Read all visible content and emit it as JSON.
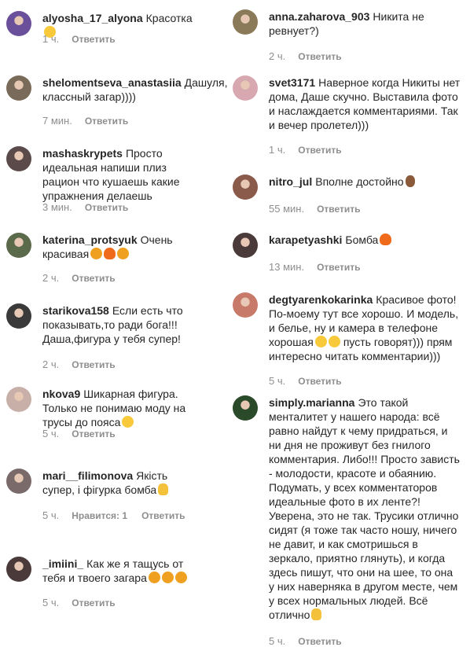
{
  "reply_label": "Ответить",
  "left_column": [
    {
      "user": "alyosha_17_alyona",
      "text": "Красотка",
      "emoji": [
        "smile"
      ],
      "time": "1 ч.",
      "likes": "",
      "avatar_color": "#6a4f9a"
    },
    {
      "user": "shelomentseva_anastasiia",
      "text": "Дашуля, классный загар))))",
      "emoji": [],
      "time": "7 мин.",
      "likes": "",
      "avatar_color": "#7a6a5a"
    },
    {
      "user": "mashaskrypets",
      "text": "Просто идеальная напиши плиз рацион что кушаешь какие упражнения делаешь",
      "emoji": [],
      "time": "3 мин.",
      "likes": "",
      "avatar_color": "#5a4a4a"
    },
    {
      "user": "katerina_protsyuk",
      "text": "Очень красивая",
      "emoji": [
        "heart",
        "fire",
        "heart"
      ],
      "time": "2 ч.",
      "likes": "",
      "avatar_color": "#5a6a4a"
    },
    {
      "user": "starikova158",
      "text": "Если есть что показывать,то ради бога!!! Даша,фигура у тебя супер!",
      "emoji": [],
      "time": "2 ч.",
      "likes": "",
      "avatar_color": "#3a3a3a"
    },
    {
      "user": "nkova9",
      "text": "Шикарная фигура. Только не понимаю моду на трусы до пояса",
      "emoji": [
        "smile"
      ],
      "time": "5 ч.",
      "likes": "",
      "avatar_color": "#c8b0a8"
    },
    {
      "user": "mari__filimonova",
      "text": "Якість супер, і фігурка бомба",
      "emoji": [
        "thumb"
      ],
      "time": "5 ч.",
      "likes": "Нравится: 1",
      "avatar_color": "#7a6a6a"
    },
    {
      "user": "_imiini_",
      "text": "Как же я тащусь от тебя и твоего загара",
      "emoji": [
        "heart",
        "heart",
        "heart"
      ],
      "time": "5 ч.",
      "likes": "",
      "avatar_color": "#4a3a3a"
    }
  ],
  "right_column": [
    {
      "user": "anna.zaharova_903",
      "text": "Никита не ревнует?)",
      "emoji": [],
      "time": "2 ч.",
      "likes": "",
      "avatar_color": "#8a7a5a"
    },
    {
      "user": "svet3171",
      "text": "Наверное когда Никиты нет дома, Даше скучно. Выставила фото и наслаждается комментариями. Так и вечер пролетел)))",
      "emoji": [],
      "time": "1 ч.",
      "likes": "",
      "avatar_color": "#d8a8b0"
    },
    {
      "user": "nitro_jul",
      "text": "Вполне достойно",
      "emoji": [
        "ok"
      ],
      "time": "55 мин.",
      "likes": "",
      "avatar_color": "#8a5a4a"
    },
    {
      "user": "karapetyashki",
      "text": "Бомба",
      "emoji": [
        "fire"
      ],
      "time": "13 мин.",
      "likes": "",
      "avatar_color": "#4a3a3a"
    },
    {
      "user": "degtyarenkokarinka",
      "text": "Красивое фото! По-моему тут все хорошо. И модель, и белье, ну и камера в телефоне хорошая",
      "emoji": [
        "smile",
        "smile"
      ],
      "text_after": "пусть говорят))) прям интересно читать комментарии)))",
      "time": "5 ч.",
      "likes": "",
      "avatar_color": "#c87a6a"
    },
    {
      "user": "simply.marianna",
      "text": "Это такой менталитет у нашего народа: всё равно найдут к чему придраться, и ни дня не проживут без гнилого комментария. Либо!!! Просто зависть - молодости, красоте и обаянию. Подумать, у всех комментаторов идеальные фото в их ленте?! Уверена, это не так. Трусики отлично сидят (я тоже так часто ношу, ничего не давит, и как смотришься в зеркало, приятно глянуть), и когда здесь пишут, что они на шее, то она у них наверняка в другом месте, чем у всех нормальных людей. Всё отлично",
      "emoji": [
        "thumb"
      ],
      "time": "5 ч.",
      "likes": "",
      "avatar_color": "#2a4a2a"
    }
  ]
}
